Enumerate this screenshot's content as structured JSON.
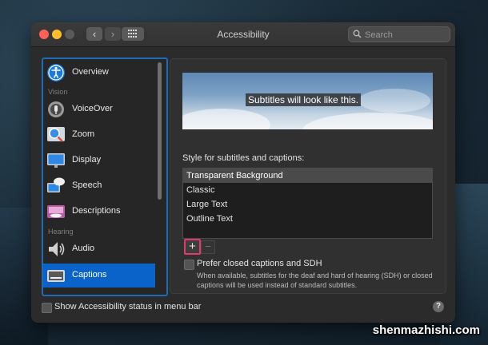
{
  "window": {
    "title": "Accessibility",
    "search_placeholder": "Search"
  },
  "sidebar": {
    "items": [
      {
        "label": "Overview",
        "icon": "accessibility-icon",
        "selected": false
      },
      {
        "label": "VoiceOver",
        "icon": "voiceover-icon",
        "selected": false
      },
      {
        "label": "Zoom",
        "icon": "zoom-icon",
        "selected": false
      },
      {
        "label": "Display",
        "icon": "display-icon",
        "selected": false
      },
      {
        "label": "Speech",
        "icon": "speech-icon",
        "selected": false
      },
      {
        "label": "Descriptions",
        "icon": "descriptions-icon",
        "selected": false
      },
      {
        "label": "Audio",
        "icon": "speaker-icon",
        "selected": false
      },
      {
        "label": "Captions",
        "icon": "captions-icon",
        "selected": true
      }
    ],
    "headers": [
      "Vision",
      "Hearing"
    ]
  },
  "captions": {
    "preview_text": "Subtitles will look like this.",
    "style_label": "Style for subtitles and captions:",
    "styles": [
      "Transparent Background",
      "Classic",
      "Large Text",
      "Outline Text"
    ],
    "selected_style": "Transparent Background",
    "add_label": "+",
    "remove_label": "−",
    "sdh_label": "Prefer closed captions and SDH",
    "sdh_checked": false,
    "sdh_description": "When available, subtitles for the deaf and hard of hearing (SDH) or closed captions will be used instead of standard subtitles."
  },
  "footer": {
    "status_label": "Show Accessibility status in menu bar",
    "status_checked": false,
    "help_label": "?"
  },
  "watermark": "shenmazhishi.com",
  "colors": {
    "selection": "#0a63c8",
    "highlight_border": "#e03a6a"
  }
}
